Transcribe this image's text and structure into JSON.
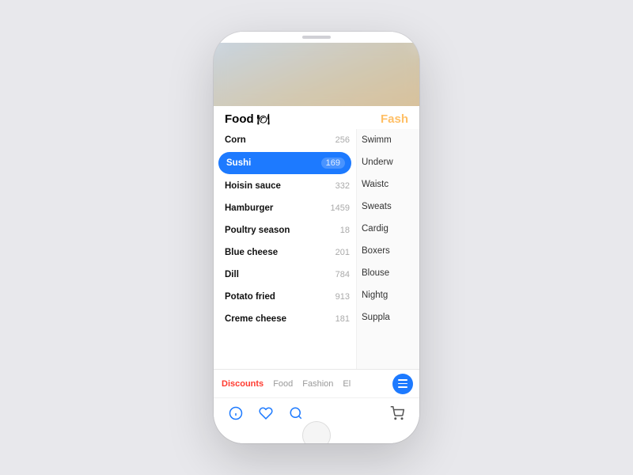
{
  "phone": {
    "speaker_label": "speaker"
  },
  "hero": {
    "label": "hero-image"
  },
  "categories": {
    "left_label": "Food",
    "left_icon": "🍽",
    "right_label": "Fash"
  },
  "food_items": [
    {
      "name": "Corn",
      "count": "256",
      "selected": false
    },
    {
      "name": "Sushi",
      "count": "169",
      "selected": true
    },
    {
      "name": "Hoisin sauce",
      "count": "332",
      "selected": false
    },
    {
      "name": "Hamburger",
      "count": "1459",
      "selected": false
    },
    {
      "name": "Poultry season",
      "count": "18",
      "selected": false
    },
    {
      "name": "Blue cheese",
      "count": "201",
      "selected": false
    },
    {
      "name": "Dill",
      "count": "784",
      "selected": false
    },
    {
      "name": "Potato fried",
      "count": "913",
      "selected": false
    },
    {
      "name": "Creme cheese",
      "count": "181",
      "selected": false
    }
  ],
  "fashion_items": [
    {
      "name": "Swimm"
    },
    {
      "name": "Underw"
    },
    {
      "name": "Waistc"
    },
    {
      "name": "Sweats"
    },
    {
      "name": "Cardig"
    },
    {
      "name": "Boxers"
    },
    {
      "name": "Blouse"
    },
    {
      "name": "Nightg"
    },
    {
      "name": "Suppla"
    }
  ],
  "bottom_tabs": [
    {
      "label": "Discounts",
      "active": true
    },
    {
      "label": "Food",
      "active": false
    },
    {
      "label": "Fashion",
      "active": false
    },
    {
      "label": "El",
      "active": false
    }
  ],
  "action_icons": {
    "info_label": "ℹ",
    "heart_label": "♡",
    "search_label": "⌕",
    "cart_label": "🛒"
  }
}
